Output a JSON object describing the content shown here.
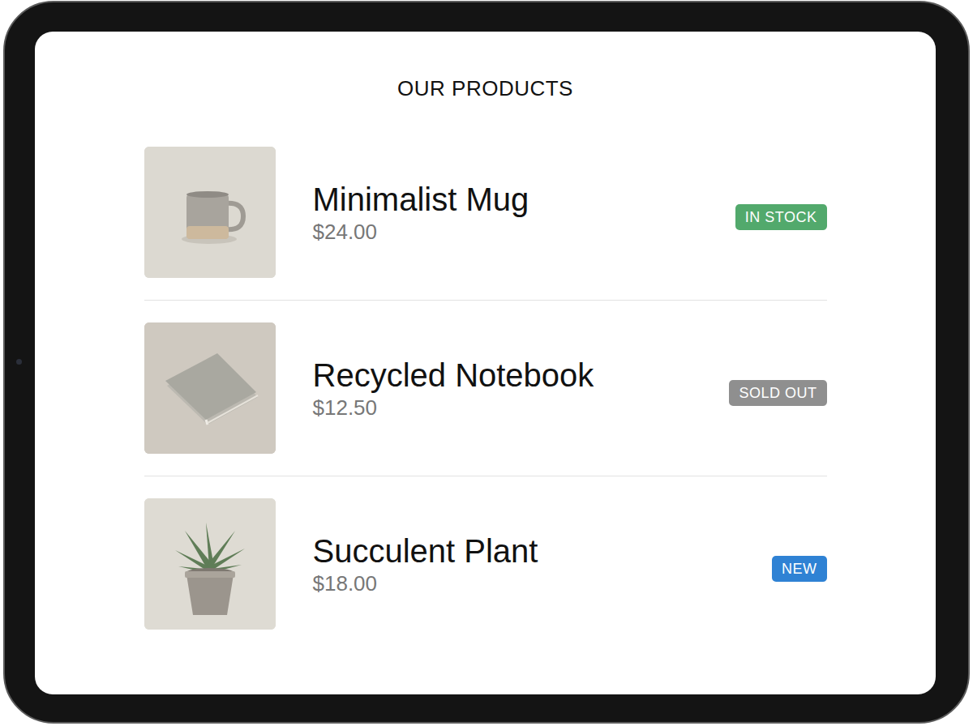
{
  "title": "OUR PRODUCTS",
  "products": [
    {
      "name": "Minimalist Mug",
      "price": "$24.00",
      "badge": "IN STOCK",
      "color": "#52a96c"
    },
    {
      "name": "Recycled Notebook",
      "price": "$12.50",
      "badge": "SOLD OUT",
      "color": "#8f8f8f"
    },
    {
      "name": "Succulent Plant",
      "price": "$18.00",
      "badge": "NEW",
      "color": "#2f82d4"
    }
  ]
}
